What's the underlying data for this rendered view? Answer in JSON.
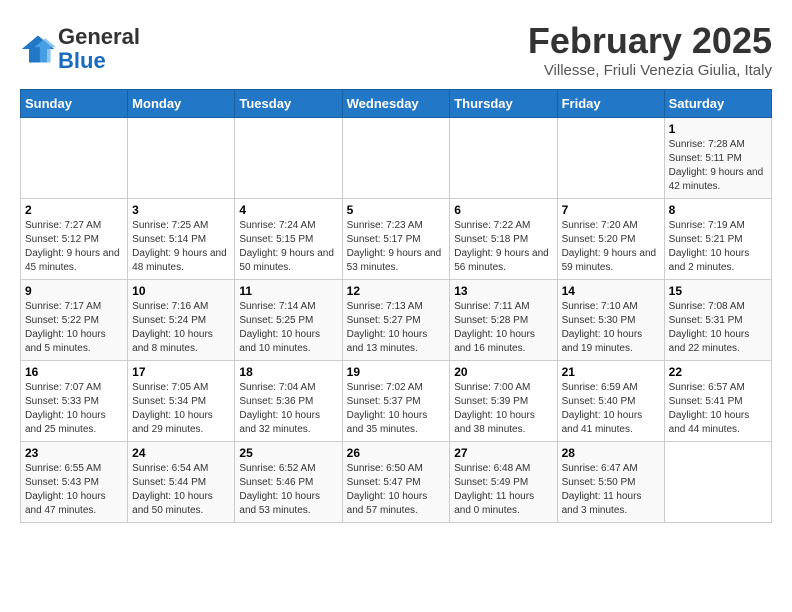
{
  "header": {
    "logo_line1": "General",
    "logo_line2": "Blue",
    "title": "February 2025",
    "subtitle": "Villesse, Friuli Venezia Giulia, Italy"
  },
  "days_of_week": [
    "Sunday",
    "Monday",
    "Tuesday",
    "Wednesday",
    "Thursday",
    "Friday",
    "Saturday"
  ],
  "weeks": [
    [
      {
        "day": "",
        "detail": ""
      },
      {
        "day": "",
        "detail": ""
      },
      {
        "day": "",
        "detail": ""
      },
      {
        "day": "",
        "detail": ""
      },
      {
        "day": "",
        "detail": ""
      },
      {
        "day": "",
        "detail": ""
      },
      {
        "day": "1",
        "detail": "Sunrise: 7:28 AM\nSunset: 5:11 PM\nDaylight: 9 hours and 42 minutes."
      }
    ],
    [
      {
        "day": "2",
        "detail": "Sunrise: 7:27 AM\nSunset: 5:12 PM\nDaylight: 9 hours and 45 minutes."
      },
      {
        "day": "3",
        "detail": "Sunrise: 7:25 AM\nSunset: 5:14 PM\nDaylight: 9 hours and 48 minutes."
      },
      {
        "day": "4",
        "detail": "Sunrise: 7:24 AM\nSunset: 5:15 PM\nDaylight: 9 hours and 50 minutes."
      },
      {
        "day": "5",
        "detail": "Sunrise: 7:23 AM\nSunset: 5:17 PM\nDaylight: 9 hours and 53 minutes."
      },
      {
        "day": "6",
        "detail": "Sunrise: 7:22 AM\nSunset: 5:18 PM\nDaylight: 9 hours and 56 minutes."
      },
      {
        "day": "7",
        "detail": "Sunrise: 7:20 AM\nSunset: 5:20 PM\nDaylight: 9 hours and 59 minutes."
      },
      {
        "day": "8",
        "detail": "Sunrise: 7:19 AM\nSunset: 5:21 PM\nDaylight: 10 hours and 2 minutes."
      }
    ],
    [
      {
        "day": "9",
        "detail": "Sunrise: 7:17 AM\nSunset: 5:22 PM\nDaylight: 10 hours and 5 minutes."
      },
      {
        "day": "10",
        "detail": "Sunrise: 7:16 AM\nSunset: 5:24 PM\nDaylight: 10 hours and 8 minutes."
      },
      {
        "day": "11",
        "detail": "Sunrise: 7:14 AM\nSunset: 5:25 PM\nDaylight: 10 hours and 10 minutes."
      },
      {
        "day": "12",
        "detail": "Sunrise: 7:13 AM\nSunset: 5:27 PM\nDaylight: 10 hours and 13 minutes."
      },
      {
        "day": "13",
        "detail": "Sunrise: 7:11 AM\nSunset: 5:28 PM\nDaylight: 10 hours and 16 minutes."
      },
      {
        "day": "14",
        "detail": "Sunrise: 7:10 AM\nSunset: 5:30 PM\nDaylight: 10 hours and 19 minutes."
      },
      {
        "day": "15",
        "detail": "Sunrise: 7:08 AM\nSunset: 5:31 PM\nDaylight: 10 hours and 22 minutes."
      }
    ],
    [
      {
        "day": "16",
        "detail": "Sunrise: 7:07 AM\nSunset: 5:33 PM\nDaylight: 10 hours and 25 minutes."
      },
      {
        "day": "17",
        "detail": "Sunrise: 7:05 AM\nSunset: 5:34 PM\nDaylight: 10 hours and 29 minutes."
      },
      {
        "day": "18",
        "detail": "Sunrise: 7:04 AM\nSunset: 5:36 PM\nDaylight: 10 hours and 32 minutes."
      },
      {
        "day": "19",
        "detail": "Sunrise: 7:02 AM\nSunset: 5:37 PM\nDaylight: 10 hours and 35 minutes."
      },
      {
        "day": "20",
        "detail": "Sunrise: 7:00 AM\nSunset: 5:39 PM\nDaylight: 10 hours and 38 minutes."
      },
      {
        "day": "21",
        "detail": "Sunrise: 6:59 AM\nSunset: 5:40 PM\nDaylight: 10 hours and 41 minutes."
      },
      {
        "day": "22",
        "detail": "Sunrise: 6:57 AM\nSunset: 5:41 PM\nDaylight: 10 hours and 44 minutes."
      }
    ],
    [
      {
        "day": "23",
        "detail": "Sunrise: 6:55 AM\nSunset: 5:43 PM\nDaylight: 10 hours and 47 minutes."
      },
      {
        "day": "24",
        "detail": "Sunrise: 6:54 AM\nSunset: 5:44 PM\nDaylight: 10 hours and 50 minutes."
      },
      {
        "day": "25",
        "detail": "Sunrise: 6:52 AM\nSunset: 5:46 PM\nDaylight: 10 hours and 53 minutes."
      },
      {
        "day": "26",
        "detail": "Sunrise: 6:50 AM\nSunset: 5:47 PM\nDaylight: 10 hours and 57 minutes."
      },
      {
        "day": "27",
        "detail": "Sunrise: 6:48 AM\nSunset: 5:49 PM\nDaylight: 11 hours and 0 minutes."
      },
      {
        "day": "28",
        "detail": "Sunrise: 6:47 AM\nSunset: 5:50 PM\nDaylight: 11 hours and 3 minutes."
      },
      {
        "day": "",
        "detail": ""
      }
    ]
  ]
}
